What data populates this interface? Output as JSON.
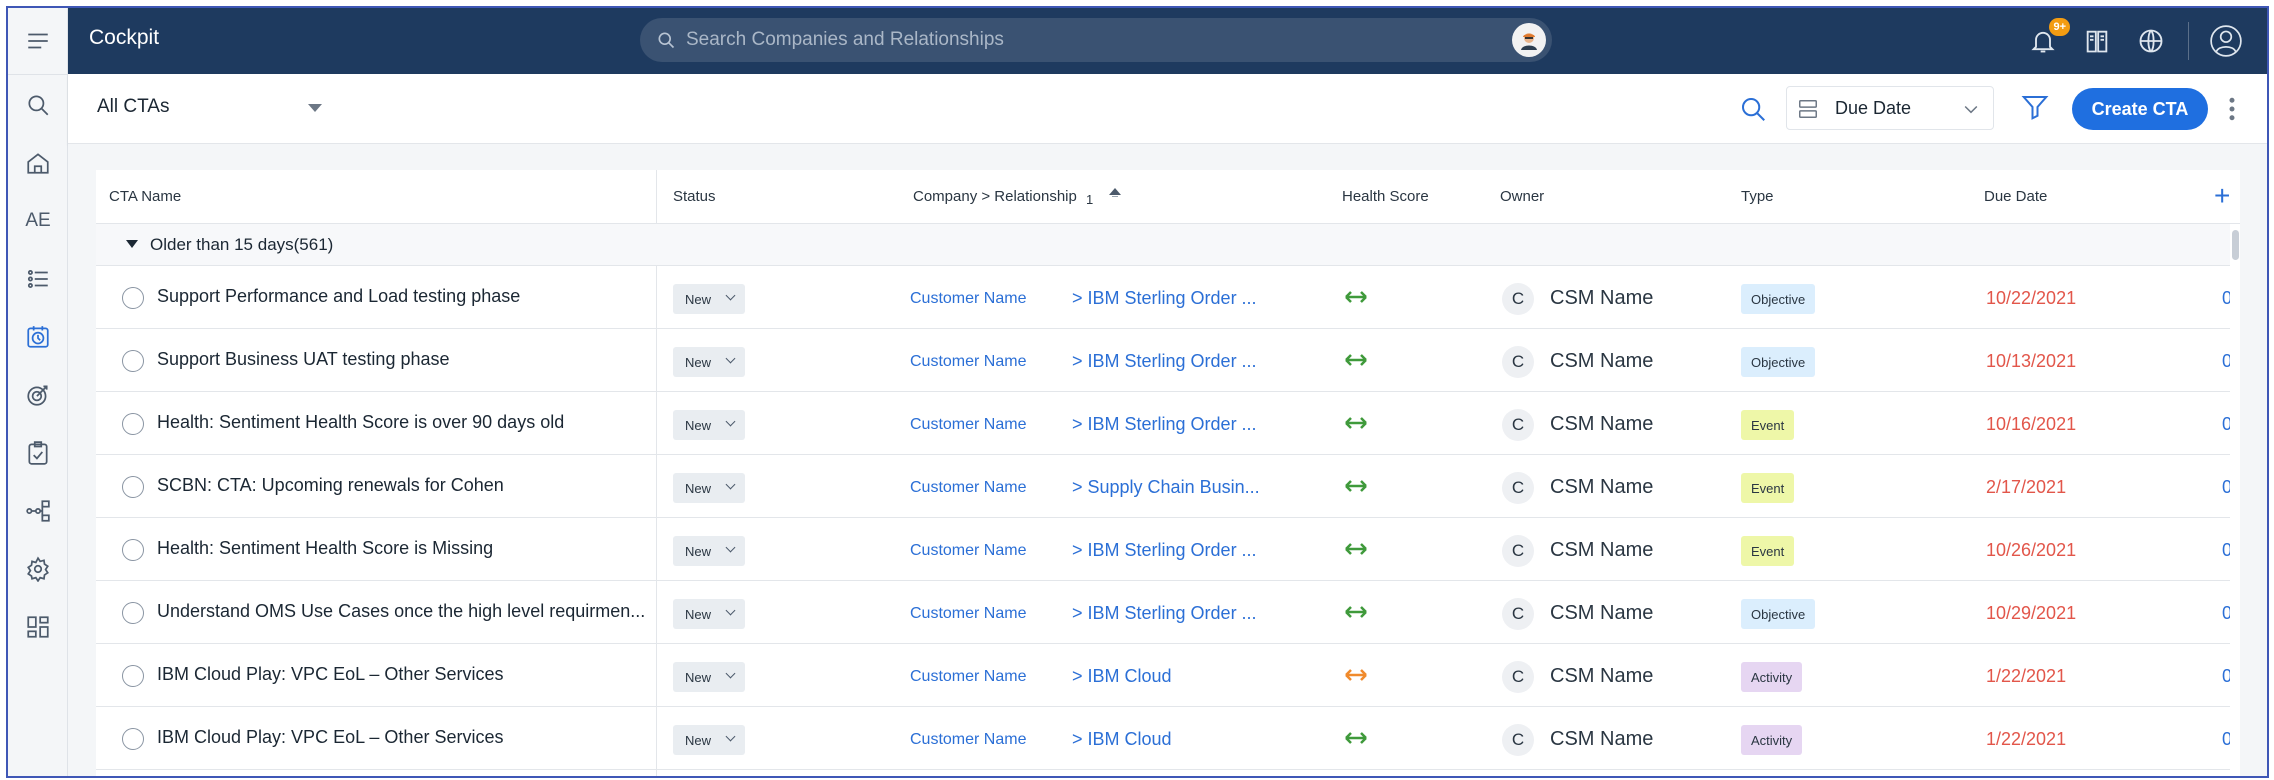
{
  "app": {
    "title": "Cockpit"
  },
  "search": {
    "placeholder": "Search Companies and Relationships"
  },
  "notifications": {
    "badge": "9+"
  },
  "subbar": {
    "view": "All CTAs",
    "sort_label": "Due Date",
    "create_label": "Create CTA"
  },
  "rail": {
    "ae_label": "AE"
  },
  "table": {
    "columns": {
      "cta_name": "CTA Name",
      "status": "Status",
      "company": "Company > Relationship",
      "company_sort_index": "1",
      "health": "Health Score",
      "owner": "Owner",
      "type": "Type",
      "due_date": "Due Date"
    },
    "group_label": "Older than 15 days(561)",
    "rows": [
      {
        "name": "Support Performance and Load testing phase",
        "status": "New",
        "company": "Customer Name",
        "relationship": "> IBM Sterling Order ...",
        "health_color": "#3f9a3b",
        "owner_initial": "C",
        "owner": "CSM Name",
        "type": "Objective",
        "type_color": "#dbeefd",
        "due": "10/22/2021",
        "extra": "0"
      },
      {
        "name": "Support Business UAT testing phase",
        "status": "New",
        "company": "Customer Name",
        "relationship": "> IBM Sterling Order ...",
        "health_color": "#3f9a3b",
        "owner_initial": "C",
        "owner": "CSM Name",
        "type": "Objective",
        "type_color": "#dbeefd",
        "due": "10/13/2021",
        "extra": "0"
      },
      {
        "name": "Health: Sentiment Health Score is over 90 days old",
        "status": "New",
        "company": "Customer Name",
        "relationship": "> IBM Sterling Order ...",
        "health_color": "#3f9a3b",
        "owner_initial": "C",
        "owner": "CSM Name",
        "type": "Event",
        "type_color": "#eef7a8",
        "due": "10/16/2021",
        "extra": "0"
      },
      {
        "name": "SCBN: CTA: Upcoming renewals for Cohen",
        "status": "New",
        "company": "Customer Name",
        "relationship": "> Supply Chain Busin...",
        "health_color": "#3f9a3b",
        "owner_initial": "C",
        "owner": "CSM Name",
        "type": "Event",
        "type_color": "#eef7a8",
        "due": "2/17/2021",
        "extra": "0"
      },
      {
        "name": "Health: Sentiment Health Score is Missing",
        "status": "New",
        "company": "Customer Name",
        "relationship": "> IBM Sterling Order ...",
        "health_color": "#3f9a3b",
        "owner_initial": "C",
        "owner": "CSM Name",
        "type": "Event",
        "type_color": "#eef7a8",
        "due": "10/26/2021",
        "extra": "0"
      },
      {
        "name": "Understand OMS Use Cases once the high level requirmen...",
        "status": "New",
        "company": "Customer Name",
        "relationship": "> IBM Sterling Order ...",
        "health_color": "#3f9a3b",
        "owner_initial": "C",
        "owner": "CSM Name",
        "type": "Objective",
        "type_color": "#dbeefd",
        "due": "10/29/2021",
        "extra": "0"
      },
      {
        "name": "IBM Cloud Play: VPC EoL – Other Services",
        "status": "New",
        "company": "Customer Name",
        "relationship": "> IBM Cloud",
        "health_color": "#f08a2c",
        "owner_initial": "C",
        "owner": "CSM Name",
        "type": "Activity",
        "type_color": "#e6d6f2",
        "due": "1/22/2021",
        "extra": "0"
      },
      {
        "name": "IBM Cloud Play: VPC EoL – Other Services",
        "status": "New",
        "company": "Customer Name",
        "relationship": "> IBM Cloud",
        "health_color": "#3f9a3b",
        "owner_initial": "C",
        "owner": "CSM Name",
        "type": "Activity",
        "type_color": "#e6d6f2",
        "due": "1/22/2021",
        "extra": "0"
      }
    ]
  },
  "colors": {
    "topbar": "#1e3a5f",
    "accent": "#1f6fe0",
    "due_overdue": "#e2564a"
  },
  "icons": [
    "menu-icon",
    "search-icon",
    "home-icon",
    "list-icon",
    "cockpit-icon",
    "target-icon",
    "clipboard-icon",
    "flow-icon",
    "gear-icon",
    "dashboard-icon",
    "bell-icon",
    "book-icon",
    "globe-icon",
    "user-icon",
    "sort-icon",
    "filter-icon",
    "kebab-icon",
    "plus-icon"
  ]
}
